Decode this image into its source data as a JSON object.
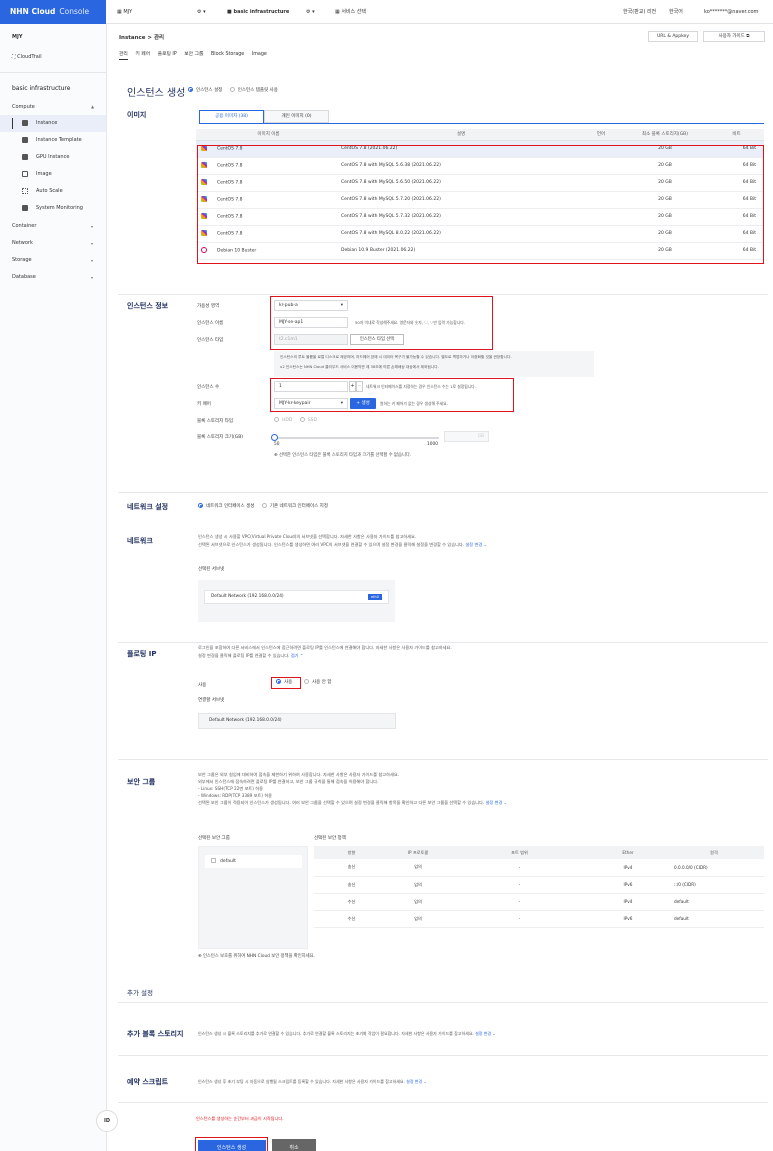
{
  "topbar": {
    "logo": "NHN Cloud",
    "logo_sub": "Console",
    "org": "MJY",
    "project": "basic infrastructure",
    "service_select": "서비스 선택",
    "region": "한국(판교) 리전",
    "language": "한국어",
    "account": "ko*******@naver.com"
  },
  "sidebar": {
    "org": "MJY",
    "cloudtrail": "CloudTrail",
    "project": "basic infrastructure",
    "compute": "Compute",
    "compute_items": [
      {
        "label": "Instance",
        "icon": "instance-icon"
      },
      {
        "label": "Instance Template",
        "icon": "template-icon"
      },
      {
        "label": "GPU Instance",
        "icon": "gpu-icon"
      },
      {
        "label": "Image",
        "icon": "image-icon"
      },
      {
        "label": "Auto Scale",
        "icon": "autoscale-icon"
      },
      {
        "label": "System Monitoring",
        "icon": "monitor-icon"
      }
    ],
    "categories": [
      "Container",
      "Network",
      "Storage",
      "Database"
    ],
    "bottom_button": "ID"
  },
  "header": {
    "breadcrumb_1": "Instance",
    "breadcrumb_sep": ">",
    "breadcrumb_2": "관리",
    "tabs": [
      "관리",
      "키 페어",
      "플로팅 IP",
      "보안 그룹",
      "Block Storage",
      "Image"
    ],
    "appkey_btn": "URL & Appkey",
    "guide_btn": "사용자 가이드"
  },
  "create": {
    "title": "인스턴스 생성",
    "mode_settings": "인스턴스 설정",
    "mode_template": "인스턴스 템플릿 사용"
  },
  "image": {
    "label": "이미지",
    "tab_public": "공용 이미지 (38)",
    "tab_private": "개인 이미지 (0)",
    "columns": [
      "이미지 이름",
      "설명",
      "언어",
      "최소 블록 스토리지(GB)",
      "비트"
    ],
    "rows": [
      {
        "name": "CentOS 7.8",
        "desc": "CentOS 7.8 (2021.06.22)",
        "lang": "",
        "min": "20 GB",
        "bit": "64 Bit"
      },
      {
        "name": "CentOS 7.8",
        "desc": "CentOS 7.8 with MySQL 5.6.38 (2021.06.22)",
        "lang": "",
        "min": "20 GB",
        "bit": "64 Bit"
      },
      {
        "name": "CentOS 7.8",
        "desc": "CentOS 7.8 with MySQL 5.6.50 (2021.06.22)",
        "lang": "",
        "min": "20 GB",
        "bit": "64 Bit"
      },
      {
        "name": "CentOS 7.8",
        "desc": "CentOS 7.8 with MySQL 5.7.20 (2021.06.22)",
        "lang": "",
        "min": "20 GB",
        "bit": "64 Bit"
      },
      {
        "name": "CentOS 7.8",
        "desc": "CentOS 7.8 with MySQL 5.7.32 (2021.06.22)",
        "lang": "",
        "min": "20 GB",
        "bit": "64 Bit"
      },
      {
        "name": "CentOS 7.8",
        "desc": "CentOS 7.8 with MySQL 8.0.22 (2021.06.22)",
        "lang": "",
        "min": "20 GB",
        "bit": "64 Bit"
      },
      {
        "name": "Debian 10 Buster",
        "desc": "Debian 10.9 Buster (2021.06.22)",
        "lang": "",
        "min": "20 GB",
        "bit": "64 Bit"
      }
    ]
  },
  "info": {
    "label": "인스턴스 정보",
    "az_label": "가용성 영역",
    "az_value": "kr-pub-a",
    "name_label": "인스턴스 이름",
    "name_value": "MJY-se-ap1",
    "name_hint": "50자 이내로 작성해주세요. 영문자와 숫자, '-', '.'만 입력 가능합니다.",
    "type_label": "인스턴스 타입",
    "type_value": "t2.c1m1",
    "type_btn": "인스턴스 타입 선택",
    "type_note_1": "인스턴스의 루트 볼륨을 로컬 디스크로 제공하며, 하드웨어 장애 시 데이터 복구가 불가능할 수 있습니다. 별도로 백업하거나 이중화할 것을 권장합니다.",
    "type_note_2": "u2 인스턴스는 NHN Cloud 클라우드 서비스 이용약관 제 36조에 따른 손해배상 대상에서 제외됩니다.",
    "count_label": "인스턴스 수",
    "count_value": "1",
    "count_hint": "네트워크 인터페이스를 지정하는 경우 인스턴스 수는 1로 설정됩니다.",
    "key_label": "키 페어",
    "key_value": "MJY-kr-keypair",
    "key_btn": "+ 생성",
    "key_hint": "원하는 키 페어가 없는 경우 생성해 주세요.",
    "storage_type_label": "블록 스토리지 타입",
    "storage_hdd": "HDD",
    "storage_ssd": "SSD",
    "storage_size_label": "블록 스토리지 크기(GB)",
    "slider_min": "50",
    "slider_max": "1000",
    "slider_value_unit": "GB",
    "slider_value": 0,
    "storage_note": "선택한 인스턴스 타입은 블록 스토리지 타입과 크기를 선택할 수 없습니다."
  },
  "net_setting": {
    "label": "네트워크 설정",
    "opt1": "네트워크 인터페이스 생성",
    "opt2": "기존 네트워크 인터페이스 지정"
  },
  "network": {
    "label": "네트워크",
    "desc_1": "인스턴스 생성 시 사용할 VPC(Virtual Private Cloud)의 서브넷을 선택합니다. 자세한 사항은 사용자 가이드를 참고하세요.",
    "desc_2": "선택된 서브넷으로 인스턴스가 생성됩니다. 인스턴스를 생성하면 여러 VPC의 서브넷을 연결할 수 있으며 설정 변경을 클릭해 설정을 변경할 수 있습니다.",
    "change": "설정 변경",
    "subnet_label": "선택된 서브넷",
    "subnet_value": "Default Network (192.168.0.0/24)",
    "subnet_badge": "eth0"
  },
  "floating": {
    "label": "플로팅 IP",
    "desc_1": "로그인을 포함하여 다른 서비스에서 인스턴스에 접근하려면 플로팅 IP를 인스턴스에 연결해야 합니다. 자세한 사항은 사용자 가이드를 참고하세요.",
    "desc_2": "설정 변경을 클릭해 플로팅 IP를 연결할 수 있습니다.",
    "fold": "접기",
    "use_label": "사용",
    "use_on": "사용",
    "use_off": "사용 안 함",
    "subnet_label": "연결할 서브넷",
    "subnet_value": "Default Network (192.168.0.0/24)"
  },
  "security": {
    "label": "보안 그룹",
    "desc_1": "보안 그룹은 외부 침입에 대비하여 접속을 제한하기 위하여 사용합니다. 자세한 사항은 사용자 가이드를 참고하세요.",
    "desc_2": "외부에서 인스턴스에 접속하려면 플로팅 IP를 연결하고, 보안 그룹 규칙을 통해 접속을 허용해야 합니다.",
    "desc_3": "- Linux: SSH(TCP 22번 포트) 허용",
    "desc_4": "- Windows: RDP(TCP 3389 포트) 허용",
    "desc_5": "선택된 보안 그룹이 적용되어 인스턴스가 생성됩니다. 여러 보안 그룹을 선택할 수 있으며 설정 변경을 클릭해 항목을 확인하고 다른 보안 그룹을 선택할 수 있습니다.",
    "change": "설정 변경",
    "selected_label": "선택된 보안 그룹",
    "group_name": "default",
    "policy_label": "선택된 보안 정책",
    "columns": [
      "방향",
      "IP 프로토콜",
      "포트 범위",
      "Ether",
      "원격"
    ],
    "rows": [
      [
        "송신",
        "임의",
        "-",
        "IPv4",
        "0.0.0.0/0 (CIDR)"
      ],
      [
        "송신",
        "임의",
        "-",
        "IPv6",
        "::/0 (CIDR)"
      ],
      [
        "수신",
        "임의",
        "-",
        "IPv4",
        "default"
      ],
      [
        "수신",
        "임의",
        "-",
        "IPv6",
        "default"
      ]
    ],
    "note": "인스턴스 보호를 위하여 NHN Cloud 보안 정책을 확인하세요."
  },
  "extra": {
    "title": "추가 설정",
    "storage_label": "추가 블록 스토리지",
    "storage_desc": "인스턴스 생성 시 블록 스토리지를 추가로 연결할 수 있습니다. 추가로 연결할 블록 스토리지는 초기화 작업이 필요합니다. 자세한 사항은 사용자 가이드를 참고하세요.",
    "storage_change": "설정 변경",
    "script_label": "예약 스크립트",
    "script_desc": "인스턴스 생성 후 초기 부팅 시 자동으로 실행될 스크립트를 등록할 수 있습니다. 자세한 사항은 사용자 가이드를 참고하세요.",
    "script_change": "설정 변경"
  },
  "footer": {
    "warning": "인스턴스를 생성하는 순간부터 과금이 시작됩니다.",
    "create_btn": "인스턴스 생성",
    "cancel_btn": "취소"
  },
  "colors": {
    "brand": "#2a66e0",
    "highlight": "#e0121b",
    "title": "#1d2d5e"
  }
}
